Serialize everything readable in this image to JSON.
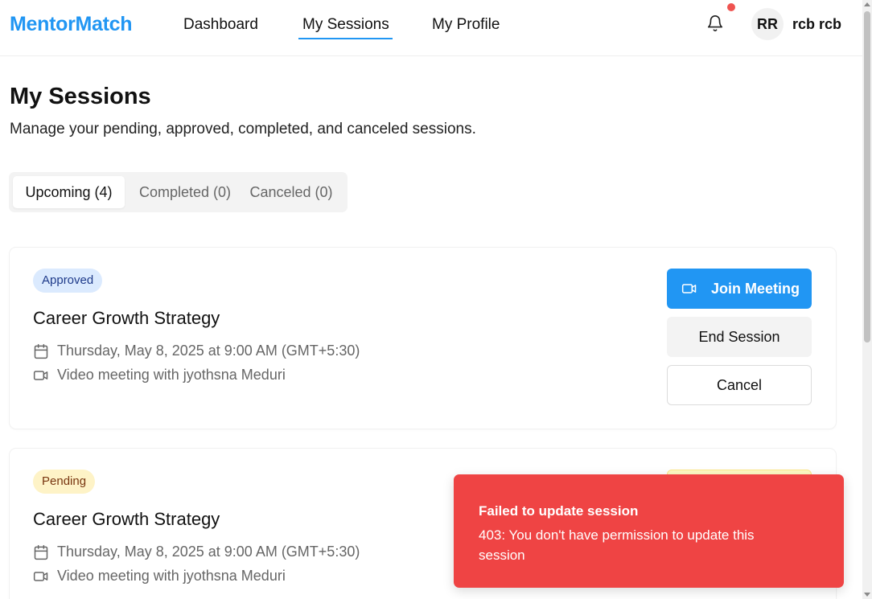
{
  "header": {
    "brand": "MentorMatch",
    "nav": [
      {
        "label": "Dashboard",
        "active": false
      },
      {
        "label": "My Sessions",
        "active": true
      },
      {
        "label": "My Profile",
        "active": false
      }
    ],
    "user_initials": "RR",
    "user_name": "rcb rcb",
    "notification_dot_color": "#ef5350"
  },
  "page": {
    "title": "My Sessions",
    "subtitle": "Manage your pending, approved, completed, and canceled sessions."
  },
  "tabs": [
    {
      "label": "Upcoming (4)",
      "active": true
    },
    {
      "label": "Completed (0)",
      "active": false
    },
    {
      "label": "Canceled (0)",
      "active": false
    }
  ],
  "sessions": [
    {
      "status": "Approved",
      "title": "Career Growth Strategy",
      "datetime": "Thursday, May 8, 2025 at 9:00 AM (GMT+5:30)",
      "meeting": "Video meeting with jyothsna Meduri",
      "actions": {
        "join": "Join Meeting",
        "end": "End Session",
        "cancel": "Cancel"
      }
    },
    {
      "status": "Pending",
      "title": "Career Growth Strategy",
      "datetime": "Thursday, May 8, 2025 at 9:00 AM (GMT+5:30)",
      "meeting": "Video meeting with jyothsna Meduri"
    }
  ],
  "toast": {
    "title": "Failed to update session",
    "message": "403: You don't have permission to update this session",
    "color": "#ef4444"
  },
  "colors": {
    "brand": "#2196f3",
    "approved_badge_bg": "#dbeafe",
    "pending_badge_bg": "#fef3c7"
  }
}
